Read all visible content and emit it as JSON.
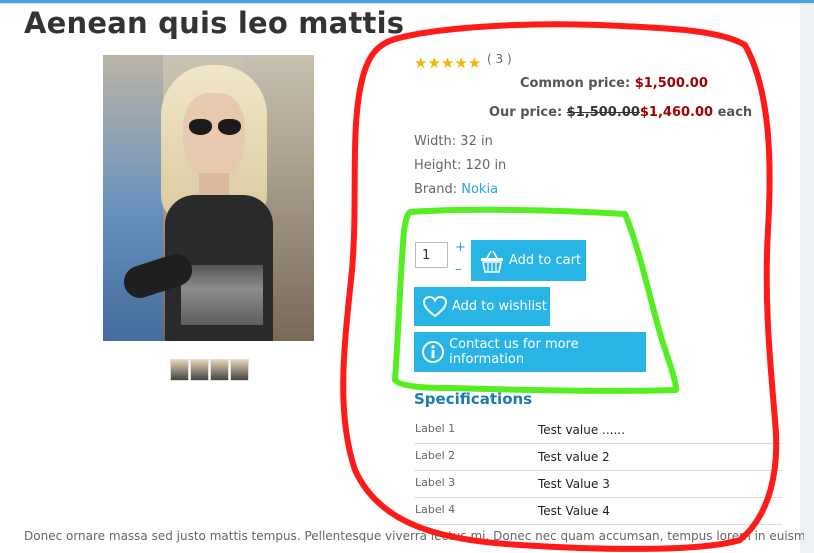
{
  "page": {
    "title": "Aenean quis leo mattis"
  },
  "product": {
    "rating": {
      "stars": 5,
      "count_text": "( 3 )"
    },
    "common_price": {
      "label": "Common price:",
      "value": "$1,500.00"
    },
    "our_price": {
      "label": "Our price:",
      "old": "$1,500.00",
      "value": "$1,460.00",
      "suffix": "each"
    },
    "attributes": [
      {
        "label": "Width:",
        "value": "32 in"
      },
      {
        "label": "Height:",
        "value": "120 in"
      },
      {
        "label": "Brand:",
        "value": "Nokia"
      }
    ],
    "quantity": {
      "value": "1",
      "plus": "+",
      "minus": "–"
    },
    "buttons": {
      "add_to_cart": "Add to cart",
      "add_to_wishlist": "Add to wishlist",
      "contact": "Contact us for more information"
    },
    "specifications": {
      "title": "Specifications",
      "rows": [
        {
          "label": "Label 1",
          "value": "Test value ......"
        },
        {
          "label": "Label 2",
          "value": "Test value 2"
        },
        {
          "label": "Label 3",
          "value": "Test Value 3"
        },
        {
          "label": "Label 4",
          "value": "Test Value 4"
        }
      ]
    },
    "description": "Donec ornare massa sed justo mattis tempus. Pellentesque viverra lectus mi. Donec nec quam accumsan, tempus lorem in euismod"
  },
  "colors": {
    "accent": "#29b4e6",
    "price_red": "#a40000",
    "annotation_red": "#ff1a1a",
    "annotation_green": "#55ee22"
  },
  "icons": {
    "cart": "basket-icon",
    "wishlist": "heart-icon",
    "contact": "info-icon",
    "rating": "star-icon"
  }
}
